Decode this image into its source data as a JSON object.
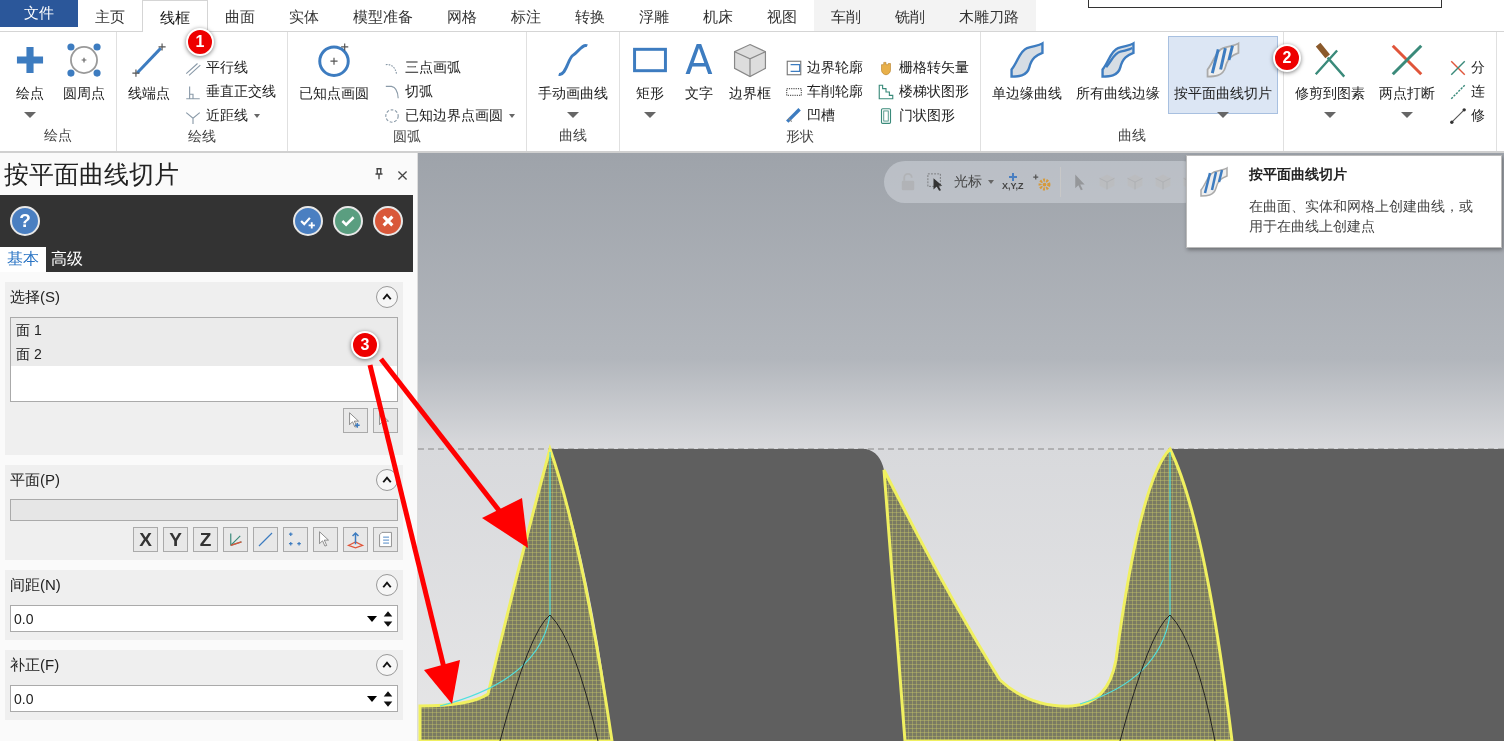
{
  "ribbon_tabs": [
    {
      "label": "文件",
      "kind": "file",
      "selected": false
    },
    {
      "label": "主页",
      "kind": "normal",
      "selected": false
    },
    {
      "label": "线框",
      "kind": "normal",
      "selected": true
    },
    {
      "label": "曲面",
      "kind": "normal",
      "selected": false
    },
    {
      "label": "实体",
      "kind": "normal",
      "selected": false
    },
    {
      "label": "模型准备",
      "kind": "normal",
      "selected": false
    },
    {
      "label": "网格",
      "kind": "normal",
      "selected": false
    },
    {
      "label": "标注",
      "kind": "normal",
      "selected": false
    },
    {
      "label": "转换",
      "kind": "normal",
      "selected": false
    },
    {
      "label": "浮雕",
      "kind": "normal",
      "selected": false
    },
    {
      "label": "机床",
      "kind": "normal",
      "selected": false
    },
    {
      "label": "视图",
      "kind": "normal",
      "selected": false
    },
    {
      "label": "车削",
      "kind": "contextual",
      "selected": false
    },
    {
      "label": "铣削",
      "kind": "contextual",
      "selected": false
    },
    {
      "label": "木雕刀路",
      "kind": "contextual",
      "selected": false
    }
  ],
  "ribbon_groups": [
    {
      "label": "绘点",
      "items": [
        {
          "kind": "large",
          "label": "绘点",
          "dropdown": true,
          "selected": false
        },
        {
          "kind": "large",
          "label": "圆周点",
          "dropdown": false,
          "selected": false
        }
      ]
    },
    {
      "label": "绘线",
      "items": [
        {
          "kind": "large",
          "label": "线端点",
          "dropdown": false,
          "selected": false
        },
        {
          "kind": "small",
          "label": "平行线",
          "dropdown": false,
          "selected": false
        },
        {
          "kind": "small",
          "label": "垂直正交线",
          "dropdown": false,
          "selected": false
        },
        {
          "kind": "small",
          "label": "近距线",
          "dropdown": true,
          "selected": false
        }
      ]
    },
    {
      "label": "圆弧",
      "items": [
        {
          "kind": "large",
          "label": "已知点画圆",
          "dropdown": false,
          "selected": false
        },
        {
          "kind": "small",
          "label": "三点画弧",
          "dropdown": false,
          "selected": false
        },
        {
          "kind": "small",
          "label": "切弧",
          "dropdown": false,
          "selected": false
        },
        {
          "kind": "small",
          "label": "已知边界点画圆",
          "dropdown": true,
          "selected": false
        }
      ]
    },
    {
      "label": "曲线",
      "items": [
        {
          "kind": "large",
          "label": "手动画曲线",
          "dropdown": true,
          "selected": false
        }
      ]
    },
    {
      "label": "形状",
      "items": [
        {
          "kind": "large",
          "label": "矩形",
          "dropdown": true,
          "selected": false
        },
        {
          "kind": "large",
          "label": "文字",
          "glyph": "A",
          "dropdown": false,
          "selected": false
        },
        {
          "kind": "large",
          "label": "边界框",
          "dropdown": false,
          "selected": false
        },
        {
          "kind": "small",
          "label": "边界轮廓",
          "dropdown": false,
          "selected": false
        },
        {
          "kind": "small",
          "label": "车削轮廓",
          "dropdown": false,
          "selected": false
        },
        {
          "kind": "small",
          "label": "凹槽",
          "dropdown": false,
          "selected": false
        },
        {
          "kind": "small",
          "label": "栅格转矢量",
          "dropdown": false,
          "selected": false
        },
        {
          "kind": "small",
          "label": "楼梯状图形",
          "dropdown": false,
          "selected": false
        },
        {
          "kind": "small",
          "label": "门状图形",
          "dropdown": false,
          "selected": false
        }
      ]
    },
    {
      "label": "曲线",
      "items": [
        {
          "kind": "large",
          "label": "单边缘曲线",
          "dropdown": false,
          "selected": false
        },
        {
          "kind": "large",
          "label": "所有曲线边缘",
          "dropdown": false,
          "selected": false
        },
        {
          "kind": "large",
          "label": "按平面曲线切片",
          "dropdown": true,
          "selected": true
        }
      ]
    },
    {
      "items": [
        {
          "kind": "large",
          "label": "修剪到图素",
          "dropdown": true,
          "selected": false
        },
        {
          "kind": "large",
          "label": "两点打断",
          "dropdown": true,
          "selected": false
        },
        {
          "kind": "small",
          "label": "分",
          "dropdown": false,
          "selected": false
        },
        {
          "kind": "small",
          "label": "连",
          "dropdown": false,
          "selected": false
        },
        {
          "kind": "small",
          "label": "修",
          "dropdown": false,
          "selected": false
        }
      ]
    }
  ],
  "panel": {
    "title": "按平面曲线切片",
    "help": "?",
    "tabs": [
      {
        "label": "基本",
        "selected": true
      },
      {
        "label": "高级",
        "selected": false
      }
    ],
    "sections": [
      {
        "kind": "list",
        "title": "选择(S)",
        "expanded": true,
        "items": [
          {
            "label": "面 1",
            "selected": true
          },
          {
            "label": "面 2",
            "selected": true
          }
        ]
      },
      {
        "kind": "plane",
        "title": "平面(P)",
        "expanded": true,
        "buttons": [
          "X",
          "Y",
          "Z"
        ]
      },
      {
        "kind": "spinner",
        "title": "间距(N)",
        "expanded": true,
        "value": "0.0"
      },
      {
        "kind": "spinner",
        "title": "补正(F)",
        "expanded": true,
        "value": "0.0"
      }
    ]
  },
  "view_toolbar": {
    "mode": "光标",
    "coordinate_label": "X,Y,Z"
  },
  "tooltip": {
    "title": "按平面曲线切片",
    "text": "在曲面、实体和网格上创建曲线，或用于在曲线上创建点"
  },
  "annotations": [
    {
      "label": "1",
      "kind": "badge"
    },
    {
      "label": "2",
      "kind": "badge"
    },
    {
      "label": "3",
      "kind": "callout"
    }
  ]
}
